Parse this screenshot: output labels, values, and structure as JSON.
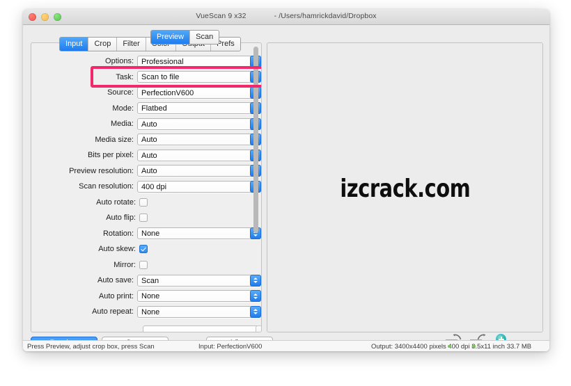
{
  "window": {
    "app_title": "VueScan 9 x32",
    "document_path": "- /Users/hamrickdavid/Dropbox",
    "traffic_lights": [
      "close-button",
      "minimize-button",
      "zoom-button"
    ]
  },
  "tabs": [
    {
      "label": "Input",
      "active": true
    },
    {
      "label": "Crop",
      "active": false
    },
    {
      "label": "Filter",
      "active": false
    },
    {
      "label": "Color",
      "active": false
    },
    {
      "label": "Output",
      "active": false
    },
    {
      "label": "Prefs",
      "active": false
    }
  ],
  "preview_tabs": [
    {
      "label": "Preview",
      "active": true
    },
    {
      "label": "Scan",
      "active": false
    }
  ],
  "form_rows": [
    {
      "label": "Options:",
      "type": "select",
      "value": "Professional"
    },
    {
      "label": "Task:",
      "type": "select",
      "value": "Scan to file"
    },
    {
      "label": "Source:",
      "type": "select",
      "value": "PerfectionV600"
    },
    {
      "label": "Mode:",
      "type": "select",
      "value": "Flatbed"
    },
    {
      "label": "Media:",
      "type": "select",
      "value": "Auto"
    },
    {
      "label": "Media size:",
      "type": "select",
      "value": "Auto"
    },
    {
      "label": "Bits per pixel:",
      "type": "select",
      "value": "Auto"
    },
    {
      "label": "Preview resolution:",
      "type": "select",
      "value": "Auto"
    },
    {
      "label": "Scan resolution:",
      "type": "select",
      "value": "400 dpi"
    },
    {
      "label": "Auto rotate:",
      "type": "checkbox",
      "checked": false
    },
    {
      "label": "Auto flip:",
      "type": "checkbox",
      "checked": false
    },
    {
      "label": "Rotation:",
      "type": "select",
      "value": "None"
    },
    {
      "label": "Auto skew:",
      "type": "checkbox",
      "checked": true
    },
    {
      "label": "Mirror:",
      "type": "checkbox",
      "checked": false
    },
    {
      "label": "Auto save:",
      "type": "select",
      "value": "Scan"
    },
    {
      "label": "Auto print:",
      "type": "select",
      "value": "None"
    },
    {
      "label": "Auto repeat:",
      "type": "select",
      "value": "None"
    }
  ],
  "highlight": {
    "target_row_label": "Options:",
    "color": "#f3286b"
  },
  "preview": {
    "watermark_text": "izcrack.com"
  },
  "buttons": {
    "preview": "Preview",
    "scan": "Scan",
    "view": "View"
  },
  "tool_icons": [
    "rotate-left-icon",
    "rotate-right-icon",
    "zoom-in-icon"
  ],
  "statusbar": {
    "left": "Press Preview, adjust crop box, press Scan",
    "center": "Input: PerfectionV600",
    "right": "Output: 3400x4400 pixels 400 dpi 8.5x11 inch 33.7 MB"
  }
}
